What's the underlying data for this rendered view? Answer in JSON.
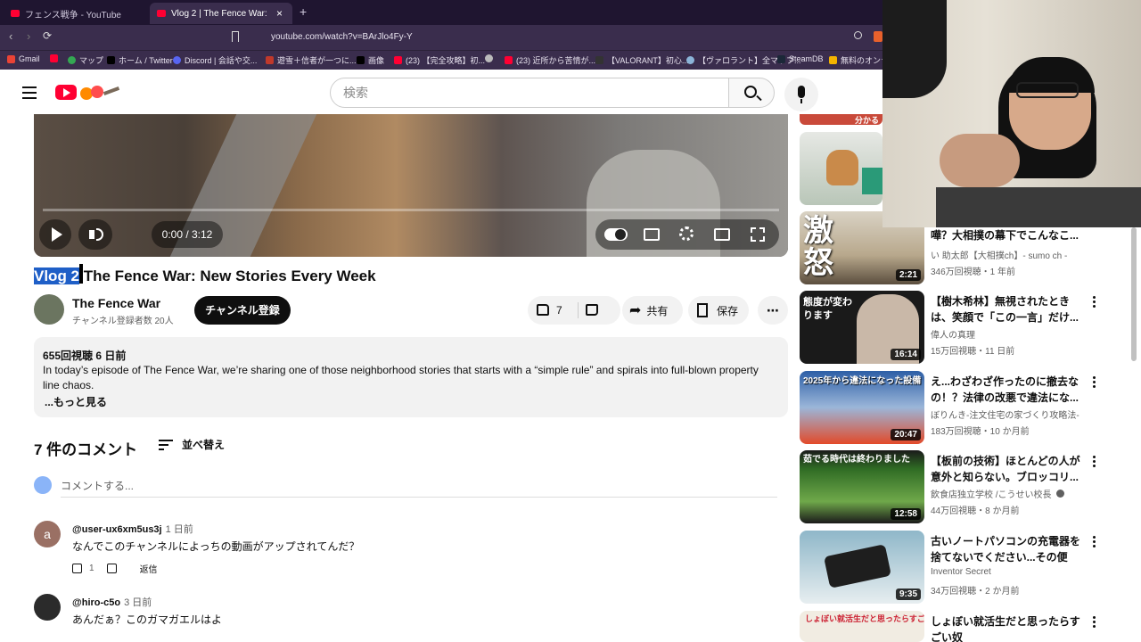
{
  "browser": {
    "tabs": [
      {
        "title": "フェンス戦争 - YouTube"
      },
      {
        "title": "Vlog 2 | The Fence War: New Sto"
      }
    ],
    "url": "youtube.com/watch?v=BArJlo4Fy-Y",
    "bookmarks": [
      "Gmail",
      "マップ",
      "ホーム / Twitter",
      "Discord | 会話や交...",
      "遊雪＋信者が一つに...",
      "画像",
      "(23) 【完全攻略】初...",
      "(23) 近所から苦情が...",
      "【VALORANT】初心...",
      "【ヴァロラント】全マップ...",
      "SteamDB",
      "無料のオンライ"
    ]
  },
  "header": {
    "search_placeholder": "検索"
  },
  "player": {
    "time": "0:00 / 3:12",
    "progress": 0
  },
  "video": {
    "title_selected": "Vlog 2",
    "title_rest": " The Fence War: New Stories Every Week",
    "channel_name": "The Fence War",
    "channel_subs": "チャンネル登録者数 20人",
    "subscribe_label": "チャンネル登録",
    "likes": "7",
    "share_label": "共有",
    "save_label": "保存"
  },
  "description": {
    "meta": "655回視聴  6 日前",
    "text": "In today’s episode of The Fence War, we’re sharing one of those neighborhood stories that starts with a “simple rule” and spirals into full-blown property line chaos.",
    "more": "...もっと見る"
  },
  "comments": {
    "title": "7 件のコメント",
    "sort_label": "並べ替え",
    "input_placeholder": "コメントする...",
    "items": [
      {
        "user": "@user-ux6xm5us3j",
        "time": "1 日前",
        "text": "なんでこのチャンネルによっちの動画がアップされてんだ？",
        "likes": "1",
        "reply": "返信",
        "avatar_letter": "a"
      },
      {
        "user": "@hiro-c5o",
        "time": "3 日前",
        "text": "あんだぁ？このガマガエルはよ",
        "likes": "",
        "reply": "返信",
        "avatar_letter": ""
      }
    ]
  },
  "sidebar": {
    "top_thumb_caption": "分かる",
    "items": [
      {
        "title": "嘩？大相撲の幕下でこんなこ...",
        "channel": "い 助太郎【大相撲ch】- sumo ch -",
        "meta": "346万回視聴・1 年前",
        "duration": "2:21",
        "thumb_text": "激怒"
      },
      {
        "title": "【樹木希林】無視されたときは、笑顔で「この一言」だけ...",
        "channel": "偉人の真理",
        "meta": "15万回視聴・11 日前",
        "duration": "16:14",
        "thumb_text": "態度が変わります"
      },
      {
        "title": "え...わざわざ作ったのに撤去なの！？法律の改悪で違法にな...",
        "channel": "ぼりんき-注文住宅の家づくり攻略法-",
        "meta": "183万回視聴・10 か月前",
        "duration": "20:47",
        "thumb_text": "2025年から違法になった設備"
      },
      {
        "title": "【板前の技術】ほとんどの人が意外と知らない。ブロッコリ...",
        "channel": "飲食店独立学校 /こうせい校長",
        "meta": "44万回視聴・8 か月前",
        "duration": "12:58",
        "thumb_text": "茹でる時代は終わりました"
      },
      {
        "title": "古いノートパソコンの充電器を捨てないでください...その便利...",
        "channel": "Inventor Secret",
        "meta": "34万回視聴・2 か月前",
        "duration": "9:35",
        "thumb_text": ""
      },
      {
        "title": "しょぼい就活生だと思ったらすごい奴",
        "channel": "",
        "meta": "",
        "duration": "",
        "thumb_text": "しょぼい就活生だと思ったらすごい奴"
      }
    ]
  },
  "colors": {
    "accent_red": "#ff0033",
    "selection_blue": "#1f5fc7",
    "chrome_bg": "#3a2d4d"
  }
}
